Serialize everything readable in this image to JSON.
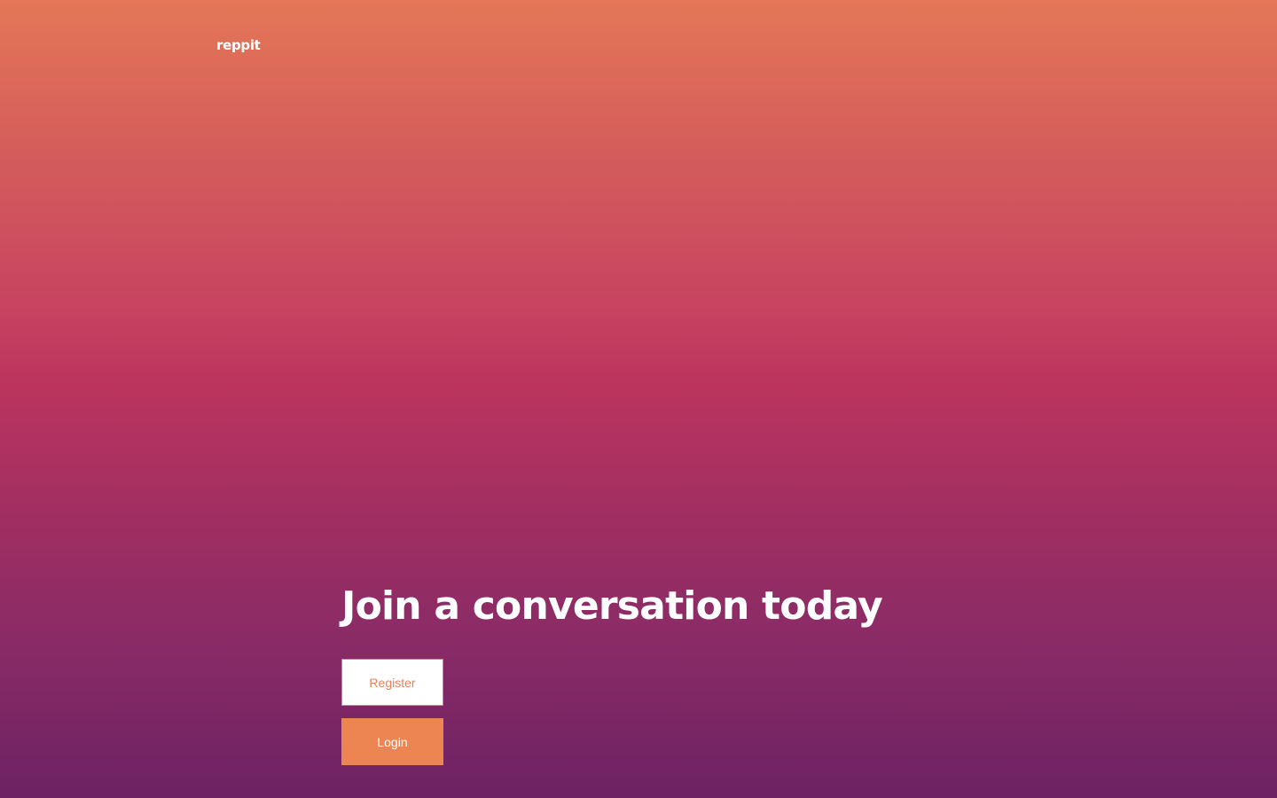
{
  "brand": {
    "name": "reppit"
  },
  "hero": {
    "headline": "Join a conversation today",
    "register_label": "Register",
    "login_label": "Login"
  },
  "colors": {
    "gradient_top": "#e47757",
    "gradient_mid": "#bd355e",
    "gradient_bottom": "#6d2263",
    "register_text": "#e8825c",
    "login_background": "#ed8552",
    "text": "#ffffff"
  }
}
